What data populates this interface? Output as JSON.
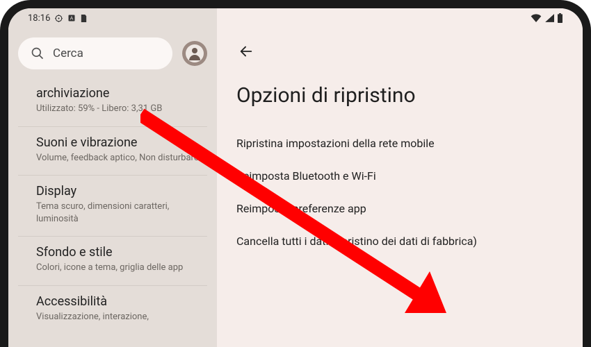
{
  "statusbar": {
    "time": "18:16"
  },
  "search": {
    "placeholder": "Cerca"
  },
  "sidebar": {
    "items": [
      {
        "title": "archiviazione",
        "sub": "Utilizzato: 59% - Libero: 3,31 GB"
      },
      {
        "title": "Suoni e vibrazione",
        "sub": "Volume, feedback aptico, Non disturbare"
      },
      {
        "title": "Display",
        "sub": "Tema scuro, dimensioni caratteri, luminosità"
      },
      {
        "title": "Sfondo e stile",
        "sub": "Colori, icone a tema, griglia delle app"
      },
      {
        "title": "Accessibilità",
        "sub": "Visualizzazione, interazione,"
      }
    ]
  },
  "content": {
    "title": "Opzioni di ripristino",
    "options": [
      "Ripristina impostazioni della rete mobile",
      "Reimposta Bluetooth e Wi-Fi",
      "Reimposta preferenze app",
      "Cancella tutti i dati (ripristino dei dati di fabbrica)"
    ]
  }
}
